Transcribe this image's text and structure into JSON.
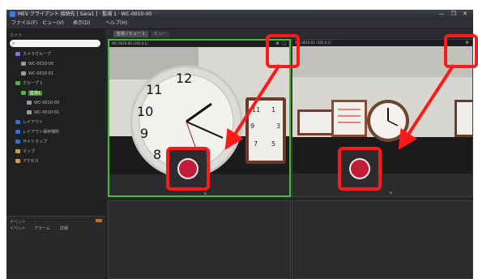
{
  "window": {
    "title": "MEV クライアント 接続先 [ Sara1 ] · 監視 1 · WC-0010-00",
    "controls": "— ❐ ✕"
  },
  "menu": [
    {
      "label": "ファイル(F)"
    },
    {
      "label": "ビュー(V)"
    },
    {
      "label": "表示(D)"
    },
    {
      "label": "ヘルプ(H)"
    }
  ],
  "left_panel": {
    "label": "カメラ",
    "search_placeholder": "",
    "tree": [
      {
        "label": "カメラグループ",
        "indent": 1,
        "icon_color": "#8a6fd0",
        "selected": false
      },
      {
        "label": "WC-0010-00",
        "indent": 2,
        "icon_color": "#9a9a9a",
        "selected": false
      },
      {
        "label": "WC-0010-01",
        "indent": 2,
        "icon_color": "#9a9a9a",
        "selected": false
      },
      {
        "label": "グループ 1",
        "indent": 1,
        "icon_color": "#56b043",
        "selected": false
      },
      {
        "label": "監視1",
        "indent": 2,
        "icon_color": "#56b043",
        "selected": true
      },
      {
        "label": "WC-0010-00",
        "indent": 3,
        "icon_color": "#9a9a9a",
        "selected": false
      },
      {
        "label": "WC-0010-01",
        "indent": 3,
        "icon_color": "#9a9a9a",
        "selected": false
      },
      {
        "label": "レイアウト",
        "indent": 1,
        "icon_color": "#3a72c9",
        "selected": false
      },
      {
        "label": "レイアウト保存場所",
        "indent": 1,
        "icon_color": "#3a72c9",
        "selected": false
      },
      {
        "label": "サイトマップ",
        "indent": 1,
        "icon_color": "#3a72c9",
        "selected": false
      },
      {
        "label": "マップ",
        "indent": 1,
        "icon_color": "#c9a13a",
        "selected": false
      },
      {
        "label": "アクセス",
        "indent": 1,
        "icon_color": "#c9a13a",
        "selected": false
      }
    ]
  },
  "lower_panel": {
    "title": "イベント",
    "tabs": [
      "イベント",
      "アラーム",
      "詳細"
    ]
  },
  "tabs": [
    {
      "label": "監視 / ビュー 1",
      "active": true
    },
    {
      "label": "ビュー",
      "active": false
    }
  ],
  "cells": {
    "left_title": "WC-0010-00 (192.0.1)",
    "right_title": "WC-0010-01 (192.0.1)",
    "left_icons": "⚙ ▢",
    "right_icons": "⚙"
  },
  "colors": {
    "accent_green": "#3fbf2a",
    "highlight_red": "#ff1a1a",
    "record_red": "#c21d37"
  }
}
